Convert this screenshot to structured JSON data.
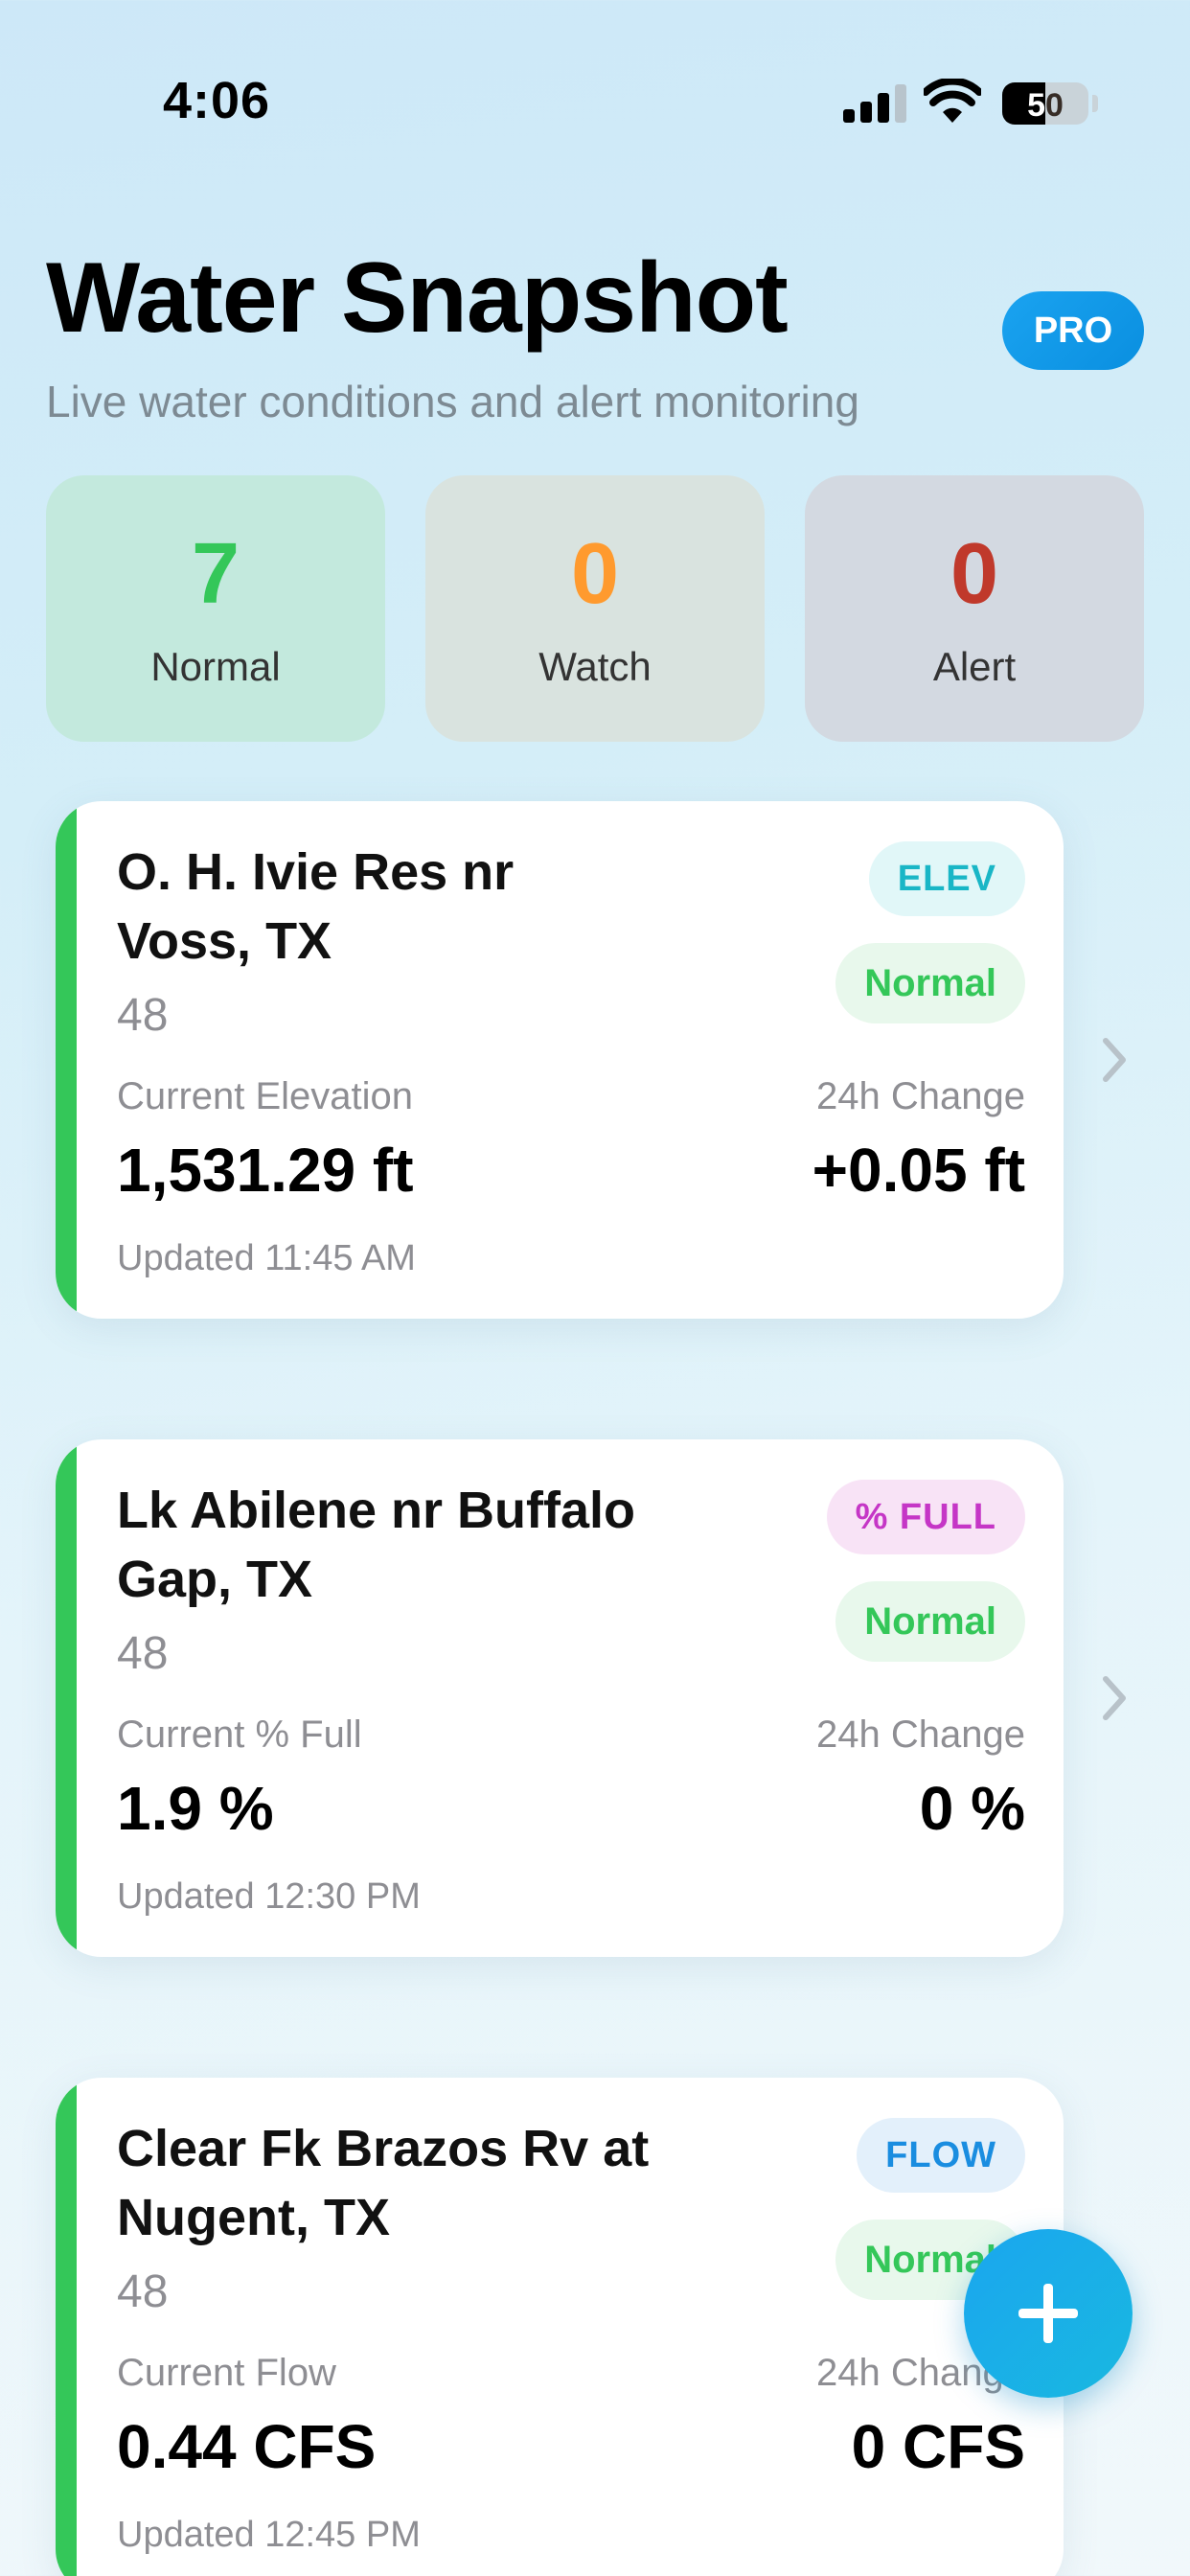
{
  "status_bar": {
    "time": "4:06",
    "battery": "50"
  },
  "header": {
    "title": "Water Snapshot",
    "badge": "PRO",
    "subtitle": "Live water conditions and alert monitoring"
  },
  "summary": [
    {
      "count": "7",
      "label": "Normal",
      "color": "#34c759"
    },
    {
      "count": "0",
      "label": "Watch",
      "color": "#ff9a2e"
    },
    {
      "count": "0",
      "label": "Alert",
      "color": "#c0392b"
    }
  ],
  "cards": [
    {
      "title": "O. H. Ivie Res nr Voss, TX",
      "id": "48",
      "type": "ELEV",
      "type_bg": "#e1f7f8",
      "type_color": "#19b6c6",
      "status": "Normal",
      "metric_label": "Current Elevation",
      "metric_value": "1,531.29 ft",
      "change_label": "24h Change",
      "change_value": "+0.05 ft",
      "updated": "Updated 11:45 AM"
    },
    {
      "title": "Lk Abilene nr Buffalo Gap, TX",
      "id": "48",
      "type": "% FULL",
      "type_bg": "#f8e3f6",
      "type_color": "#c536c6",
      "status": "Normal",
      "metric_label": "Current % Full",
      "metric_value": "1.9 %",
      "change_label": "24h Change",
      "change_value": "0 %",
      "updated": "Updated 12:30 PM"
    },
    {
      "title": "Clear Fk Brazos Rv at Nugent, TX",
      "id": "48",
      "type": "FLOW",
      "type_bg": "#e3f0fb",
      "type_color": "#1a8de0",
      "status": "Normal",
      "metric_label": "Current Flow",
      "metric_value": "0.44 CFS",
      "change_label": "24h Change",
      "change_value": "0 CFS",
      "updated": "Updated 12:45 PM"
    }
  ]
}
